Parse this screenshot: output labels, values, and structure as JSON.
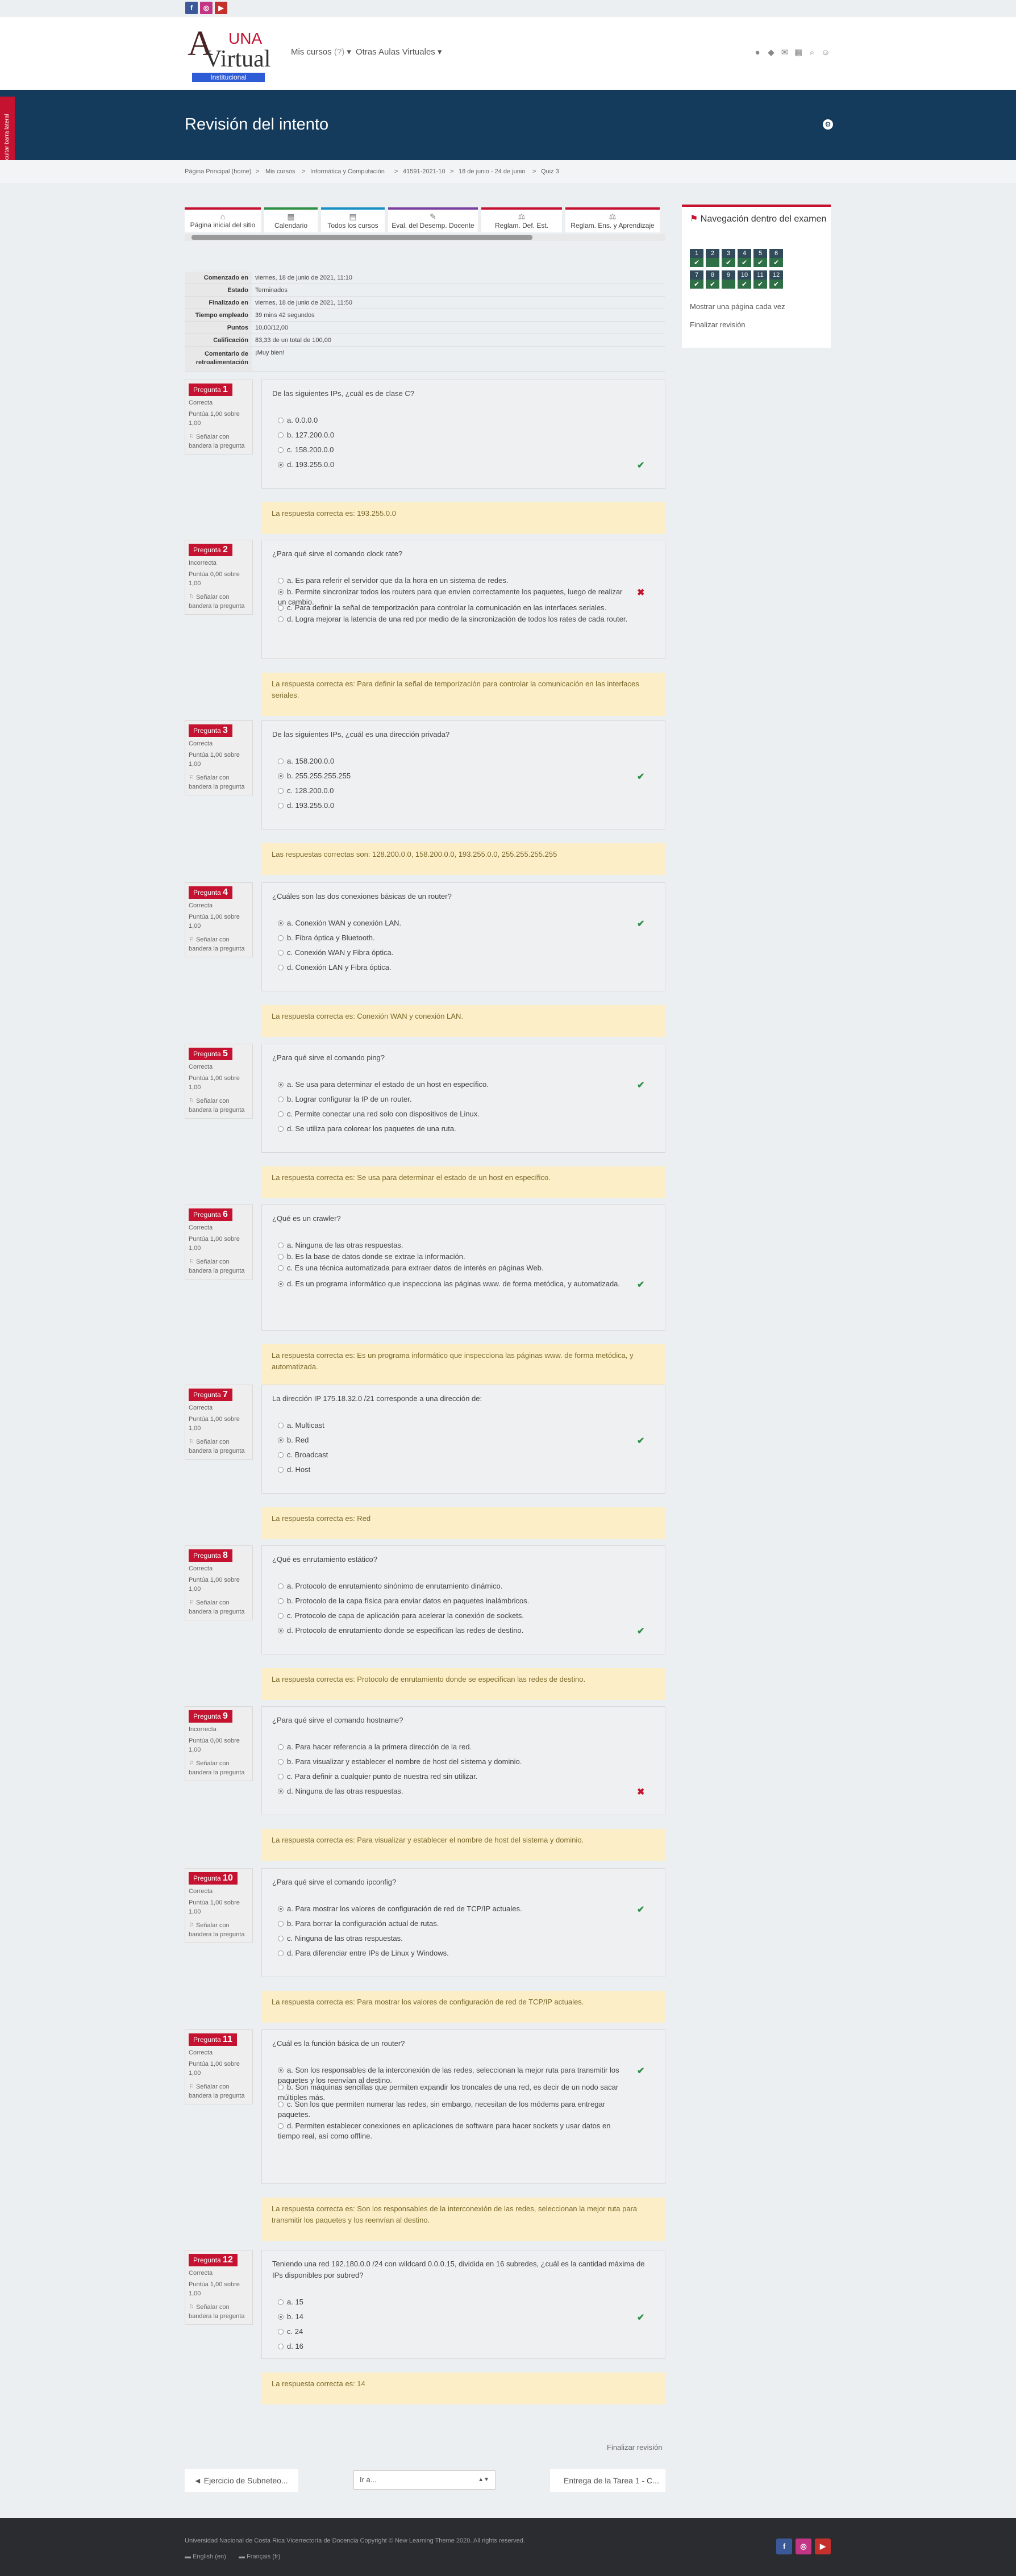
{
  "header": {
    "logo_text": "UNA",
    "logo_institucional": "Institucional",
    "menu_courses": "Mis cursos",
    "menu_virtual": "Otras Aulas Virtuales"
  },
  "sidebar_tab": "Ocultar barra lateral",
  "page_title": "Revisión del intento",
  "breadcrumb": [
    "Página Principal (home)",
    "Mis cursos",
    "Informática y Computación",
    "41591-2021-10",
    "18 de junio - 24 de junio",
    "Quiz 3"
  ],
  "dashboard": [
    {
      "label": "Página inicial del sitio",
      "icon": "home-icon",
      "color": "#c41230"
    },
    {
      "label": "Calendario",
      "icon": "calendar-icon",
      "color": "#2f8f46"
    },
    {
      "label": "Todos los cursos",
      "icon": "courses-icon",
      "color": "#1a8fc4"
    },
    {
      "label": "Eval. del Desemp. Docente",
      "icon": "evaluation-icon",
      "color": "#7a3fa0"
    },
    {
      "label": "Reglam. Def. Est.",
      "icon": "regulation-icon",
      "color": "#c41230"
    },
    {
      "label": "Reglam. Ens. y Aprendizaje",
      "icon": "regulation-icon",
      "color": "#c41230"
    }
  ],
  "summary": [
    {
      "k": "Comenzado en",
      "v": "viernes, 18 de junio de 2021, 11:10"
    },
    {
      "k": "Estado",
      "v": "Terminados"
    },
    {
      "k": "Finalizado en",
      "v": "viernes, 18 de junio de 2021, 11:50"
    },
    {
      "k": "Tiempo empleado",
      "v": "39 mins 42 segundos"
    },
    {
      "k": "Puntos",
      "v": "10,00/12,00"
    },
    {
      "k": "Calificación",
      "v": "83,33 de un total de 100,00"
    },
    {
      "k": "Comentario de retroalimentación",
      "v": "¡Muy bien!"
    }
  ],
  "quiz_nav": {
    "title": "Navegación dentro del examen",
    "show_one_page": "Mostrar una página cada vez",
    "finish_review": "Finalizar revisión",
    "items": [
      {
        "n": "1",
        "ok": true
      },
      {
        "n": "2",
        "ok": false
      },
      {
        "n": "3",
        "ok": true
      },
      {
        "n": "4",
        "ok": true
      },
      {
        "n": "5",
        "ok": true
      },
      {
        "n": "6",
        "ok": true
      },
      {
        "n": "7",
        "ok": true
      },
      {
        "n": "8",
        "ok": true
      },
      {
        "n": "9",
        "ok": false
      },
      {
        "n": "10",
        "ok": true
      },
      {
        "n": "11",
        "ok": true
      },
      {
        "n": "12",
        "ok": true
      }
    ]
  },
  "labels": {
    "question": "Pregunta",
    "flag": "Señalar con bandera la pregunta"
  },
  "questions": [
    {
      "num": "1",
      "status": "Correcta",
      "score": "Puntúa 1,00 sobre 1,00",
      "text": "De las siguientes IPs, ¿cuál es de clase C?",
      "options": [
        "a. 0.0.0.0",
        "b. 127.200.0.0",
        "c. 158.200.0.0",
        "d. 193.255.0.0"
      ],
      "selected": 3,
      "correct": true,
      "feedback": "La respuesta correcta es: 193.255.0.0"
    },
    {
      "num": "2",
      "status": "Incorrecta",
      "score": "Puntúa 0,00 sobre 1,00",
      "text": "¿Para qué sirve el comando clock rate?",
      "options": [
        "a. Es para referir el servidor que da la hora en un sistema de redes.",
        "b. Permite sincronizar todos los routers para que envíen correctamente los paquetes, luego de realizar un cambio.",
        "c. Para definir la señal de temporización para controlar la comunicación en las interfaces seriales.",
        "d. Logra mejorar la latencia de una red por medio de la sincronización de todos los rates de cada router."
      ],
      "selected": 1,
      "correct": false,
      "feedback": "La respuesta correcta es: Para definir la señal de temporización para controlar la comunicación en las interfaces seriales."
    },
    {
      "num": "3",
      "status": "Correcta",
      "score": "Puntúa 1,00 sobre 1,00",
      "text": "De las siguientes IPs, ¿cuál es una dirección privada?",
      "options": [
        "a. 158.200.0.0",
        "b. 255.255.255.255",
        "c. 128.200.0.0",
        "d. 193.255.0.0"
      ],
      "selected": 1,
      "correct": true,
      "feedback": "Las respuestas correctas son: 128.200.0.0, 158.200.0.0, 193.255.0.0, 255.255.255.255"
    },
    {
      "num": "4",
      "status": "Correcta",
      "score": "Puntúa 1,00 sobre 1,00",
      "text": "¿Cuáles son las dos conexiones básicas de un router?",
      "options": [
        "a. Conexión WAN y conexión LAN.",
        "b. Fibra óptica y Bluetooth.",
        "c. Conexión WAN y Fibra óptica.",
        "d. Conexión LAN y Fibra óptica."
      ],
      "selected": 0,
      "correct": true,
      "feedback": "La respuesta correcta es: Conexión WAN y conexión LAN."
    },
    {
      "num": "5",
      "status": "Correcta",
      "score": "Puntúa 1,00 sobre 1,00",
      "text": "¿Para qué sirve el comando ping?",
      "options": [
        "a. Se usa para determinar el estado de un host en específico.",
        "b. Lograr configurar la IP de un router.",
        "c. Permite conectar una red solo con dispositivos de Linux.",
        "d. Se utiliza para colorear los paquetes de una ruta."
      ],
      "selected": 0,
      "correct": true,
      "feedback": "La respuesta correcta es: Se usa para determinar el estado de un host en específico."
    },
    {
      "num": "6",
      "status": "Correcta",
      "score": "Puntúa 1,00 sobre 1,00",
      "text": "¿Qué es un crawler?",
      "options": [
        "a. Ninguna de las otras respuestas.",
        "b. Es la base de datos donde se extrae la información.",
        "c. Es una técnica automatizada para extraer datos de interés en páginas Web.",
        "d. Es un programa informático que inspecciona las páginas www. de forma metódica, y automatizada."
      ],
      "selected": 3,
      "correct": true,
      "feedback": "La respuesta correcta es: Es un programa informático que inspecciona las páginas www. de forma metódica, y automatizada."
    },
    {
      "num": "7",
      "status": "Correcta",
      "score": "Puntúa 1,00 sobre 1,00",
      "text": "La dirección IP 175.18.32.0 /21 corresponde a una dirección de:",
      "options": [
        "a. Multicast",
        "b. Red",
        "c. Broadcast",
        "d. Host"
      ],
      "selected": 1,
      "correct": true,
      "feedback": "La respuesta correcta es: Red"
    },
    {
      "num": "8",
      "status": "Correcta",
      "score": "Puntúa 1,00 sobre 1,00",
      "text": "¿Qué es enrutamiento estático?",
      "options": [
        "a. Protocolo de enrutamiento sinónimo de enrutamiento dinámico.",
        "b. Protocolo de la capa física para enviar datos en paquetes inalámbricos.",
        "c. Protocolo de capa de aplicación para acelerar la conexión de sockets.",
        "d. Protocolo de enrutamiento donde se especifican las redes de destino."
      ],
      "selected": 3,
      "correct": true,
      "feedback": "La respuesta correcta es: Protocolo de enrutamiento donde se especifican las redes de destino."
    },
    {
      "num": "9",
      "status": "Incorrecta",
      "score": "Puntúa 0,00 sobre 1,00",
      "text": "¿Para qué sirve el comando hostname?",
      "options": [
        "a. Para hacer referencia a la primera dirección de la red.",
        "b. Para visualizar y establecer el nombre de host del sistema y dominio.",
        "c. Para definir a cualquier punto de nuestra red sin utilizar.",
        "d. Ninguna de las otras respuestas."
      ],
      "selected": 3,
      "correct": false,
      "feedback": "La respuesta correcta es: Para visualizar y establecer el nombre de host del sistema y dominio."
    },
    {
      "num": "10",
      "status": "Correcta",
      "score": "Puntúa 1,00 sobre 1,00",
      "text": "¿Para qué sirve el comando ipconfig?",
      "options": [
        "a. Para mostrar los valores de configuración de red de TCP/IP actuales.",
        "b. Para borrar la configuración actual de rutas.",
        "c. Ninguna de las otras respuestas.",
        "d. Para diferenciar entre IPs de Linux y Windows."
      ],
      "selected": 0,
      "correct": true,
      "feedback": "La respuesta correcta es: Para mostrar los valores de configuración de red de TCP/IP actuales."
    },
    {
      "num": "11",
      "status": "Correcta",
      "score": "Puntúa 1,00 sobre 1,00",
      "text": "¿Cuál es la función básica de un router?",
      "options": [
        "a. Son los responsables de la interconexión de las redes, seleccionan la mejor ruta para transmitir los paquetes y los reenvían al destino.",
        "b. Son máquinas sencillas que permiten expandir los troncales de una red, es decir de un nodo sacar múltiples más.",
        "c. Son los que permiten numerar las redes, sin embargo, necesitan de los módems para entregar paquetes.",
        "d. Permiten establecer conexiones en aplicaciones de software para hacer sockets y usar datos en tiempo real, así como offline."
      ],
      "selected": 0,
      "correct": true,
      "feedback": "La respuesta correcta es: Son los responsables de la interconexión de las redes, seleccionan la mejor ruta para transmitir los paquetes y los reenvían al destino."
    },
    {
      "num": "12",
      "status": "Correcta",
      "score": "Puntúa 1,00 sobre 1,00",
      "text": "Teniendo una red 192.180.0.0 /24 con wildcard 0.0.0.15, dividida en 16 subredes, ¿cuál es la cantidad máxima de IPs disponibles por subred?",
      "options": [
        "a. 15",
        "b. 14",
        "c. 24",
        "d. 16"
      ],
      "selected": 1,
      "correct": true,
      "feedback": "La respuesta correcta es: 14"
    }
  ],
  "bottom": {
    "finish_review": "Finalizar revisión",
    "prev": "◄ Ejercicio de Subneteo...",
    "jump": "Ir a...",
    "next": "Entrega de la Tarea 1 - C..."
  },
  "footer": {
    "text": "Universidad Nacional de Costa Rica Vicerrectoría de Docencia Copyright © New Learning Theme 2020. All rights reserved.",
    "lang_en": "English (en)",
    "lang_fr": "Français (fr)"
  },
  "colors": {
    "brand": "#c41230",
    "banner": "#143a5c",
    "correct": "#2f8f46",
    "feedback": "#fcefc7"
  }
}
